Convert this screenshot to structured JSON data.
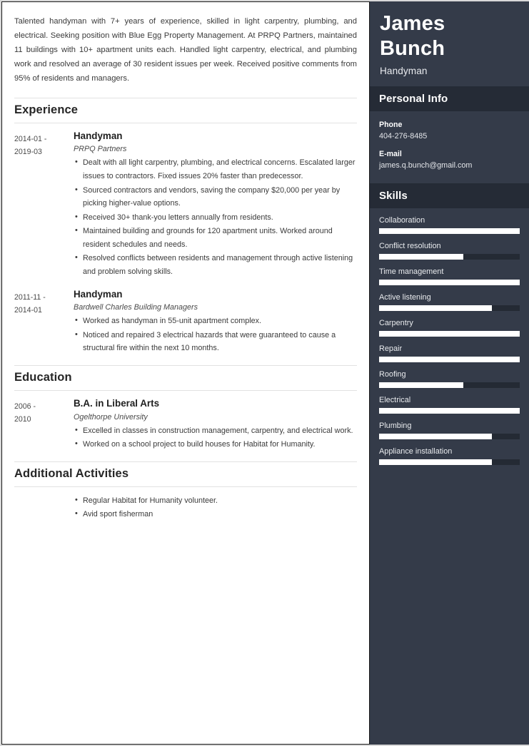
{
  "resume": {
    "summary": "Talented handyman with 7+ years of experience, skilled in light carpentry, plumbing, and electrical. Seeking position with Blue Egg Property Management. At PRPQ Partners, maintained 11 buildings with 10+ apartment units each. Handled light carpentry, electrical, and plumbing work and resolved an average of 30 resident issues per week. Received positive comments from 95% of residents and managers.",
    "sections": {
      "experience": {
        "heading": "Experience",
        "entries": [
          {
            "dates": "2014-01 - 2019-03",
            "date_start": "2014-01 -",
            "date_end": "2019-03",
            "title": "Handyman",
            "org": "PRPQ Partners",
            "bullets": [
              "Dealt with all light carpentry, plumbing, and electrical concerns. Escalated larger issues to contractors. Fixed issues 20% faster than predecessor.",
              "Sourced contractors and vendors, saving the company $20,000 per year by picking higher-value options.",
              "Received 30+ thank-you letters annually from residents.",
              "Maintained building and grounds for 120 apartment units. Worked around resident schedules and needs.",
              "Resolved conflicts between residents and management through active listening and problem solving skills."
            ]
          },
          {
            "dates": "2011-11 - 2014-01",
            "date_start": "2011-11 -",
            "date_end": "2014-01",
            "title": "Handyman",
            "org": "Bardwell Charles Building Managers",
            "bullets": [
              "Worked as handyman in 55-unit apartment complex.",
              "Noticed and repaired 3 electrical hazards that were guaranteed to cause a structural fire within the next 10 months."
            ]
          }
        ]
      },
      "education": {
        "heading": "Education",
        "entries": [
          {
            "dates": "2006 - 2010",
            "date_start": "2006 -",
            "date_end": "2010",
            "title": "B.A. in Liberal Arts",
            "org": "Ogelthorpe University",
            "bullets": [
              "Excelled in classes in construction management, carpentry, and electrical work.",
              "Worked on a school project to build houses for Habitat for Humanity."
            ]
          }
        ]
      },
      "additional": {
        "heading": "Additional Activities",
        "bullets": [
          "Regular Habitat for Humanity volunteer.",
          "Avid sport fisherman"
        ]
      }
    }
  },
  "sidebar": {
    "name_first": "James",
    "name_last": "Bunch",
    "role": "Handyman",
    "personal_info": {
      "heading": "Personal Info",
      "fields": [
        {
          "label": "Phone",
          "value": "404-276-8485"
        },
        {
          "label": "E-mail",
          "value": "james.q.bunch@gmail.com"
        }
      ]
    },
    "skills": {
      "heading": "Skills",
      "items": [
        {
          "label": "Collaboration",
          "level": 100
        },
        {
          "label": "Conflict resolution",
          "level": 60
        },
        {
          "label": "Time management",
          "level": 100
        },
        {
          "label": "Active listening",
          "level": 80
        },
        {
          "label": "Carpentry",
          "level": 100
        },
        {
          "label": "Repair",
          "level": 100
        },
        {
          "label": "Roofing",
          "level": 60
        },
        {
          "label": "Electrical",
          "level": 100
        },
        {
          "label": "Plumbing",
          "level": 80
        },
        {
          "label": "Appliance installation",
          "level": 80
        }
      ]
    }
  },
  "colors": {
    "sidebar_bg": "#343b49",
    "sidebar_header_bg": "#252b36",
    "skill_fill": "#ffffff",
    "skill_track": "#242a34",
    "page_bg": "#ffffff"
  }
}
